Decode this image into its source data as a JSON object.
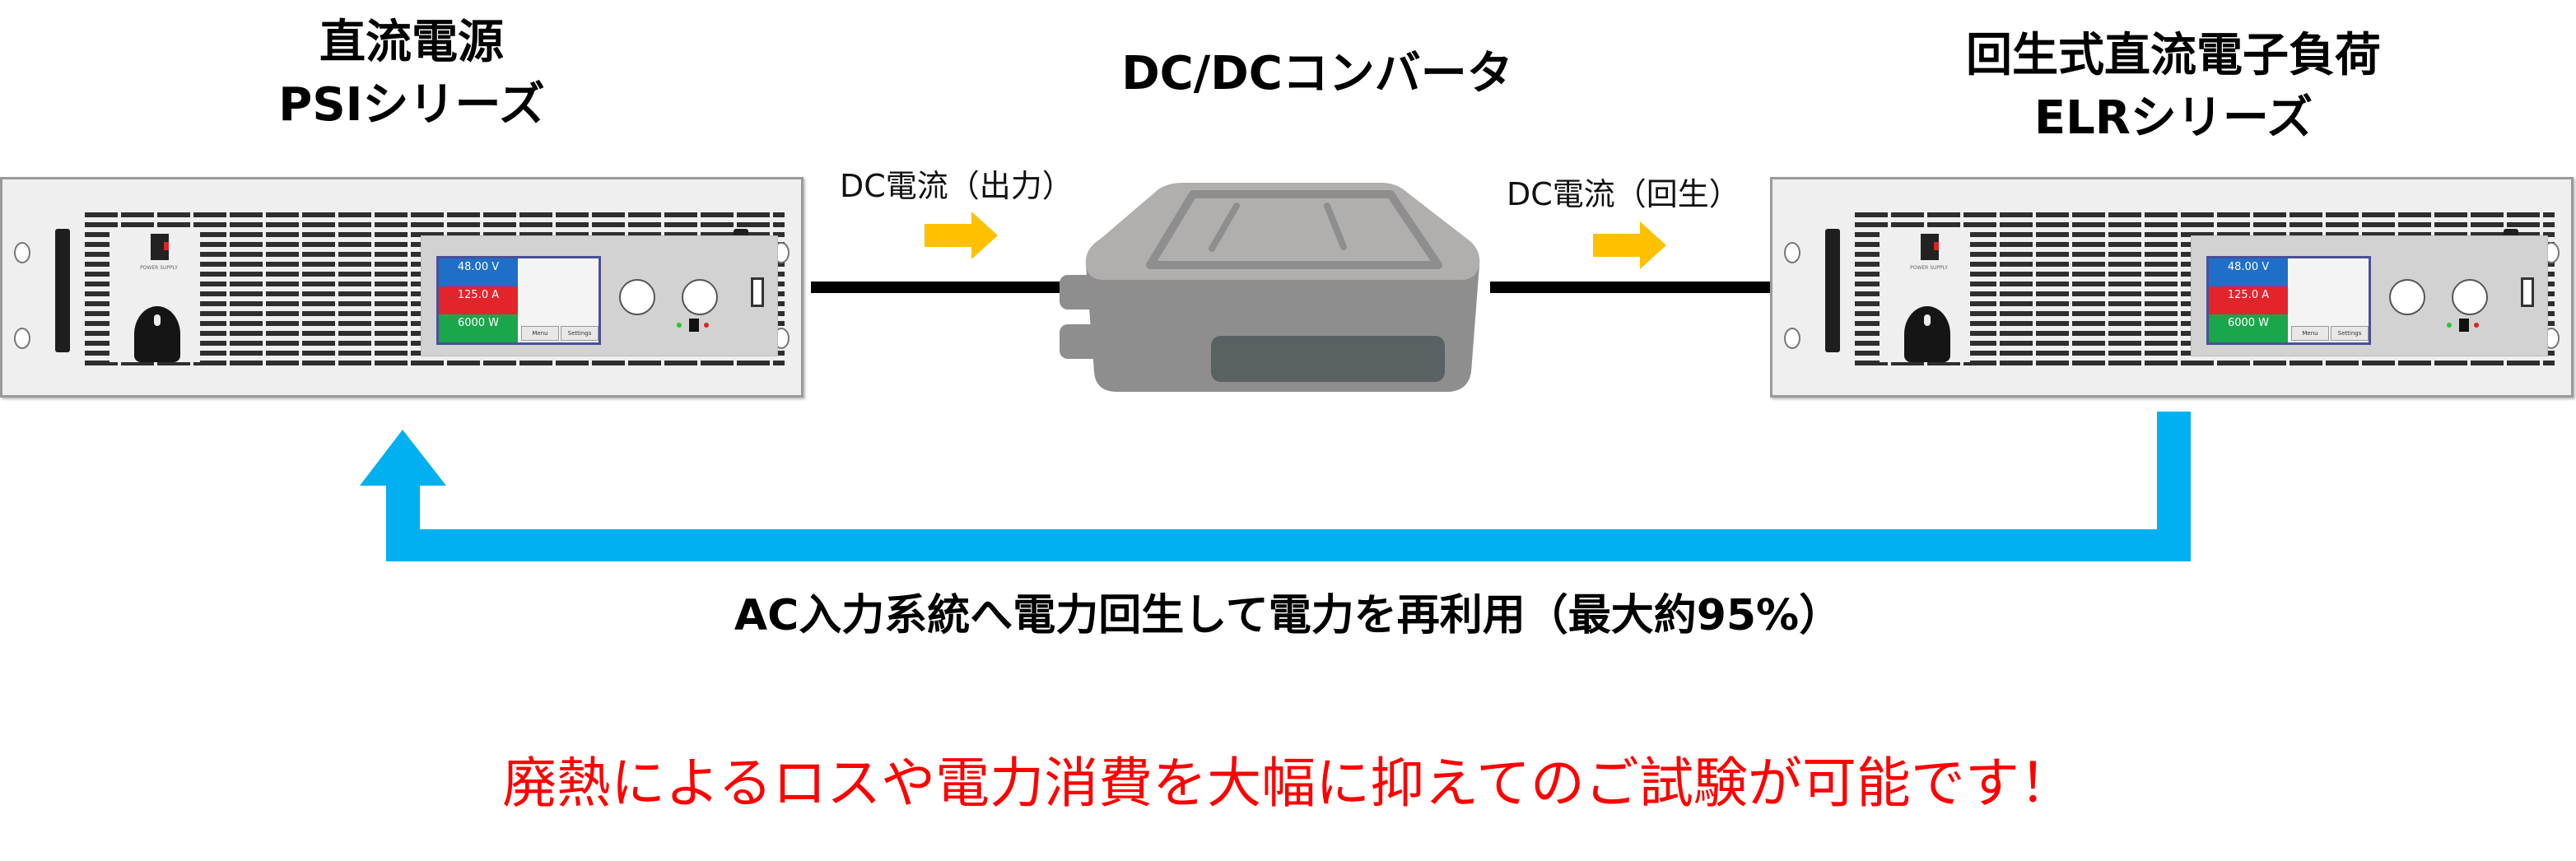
{
  "titles": {
    "psi": {
      "line1": "直流電源",
      "line2": "PSIシリーズ"
    },
    "converter": "DC/DCコンバータ",
    "elr": {
      "line1": "回生式直流電子負荷",
      "line2": "ELRシリーズ"
    }
  },
  "flow_labels": {
    "output": "DC電流（出力）",
    "regen": "DC電流（回生）"
  },
  "caption": "AC入力系統へ電力回生して電力を再利用（最大約95%）",
  "note": "廃熱によるロスや電力消費を大幅に抑えてのご試験が可能です！",
  "devices": {
    "psi": {
      "panel_text": "POWER SUPPLY",
      "display": {
        "voltage": "48.00 V",
        "current": "125.0 A",
        "power": "6000 W"
      },
      "buttons": [
        "Menu",
        "Settings"
      ]
    },
    "elr": {
      "panel_text": "POWER SUPPLY",
      "display": {
        "voltage": "48.00 V",
        "current": "125.0 A",
        "power": "6000 W"
      },
      "buttons": [
        "Menu",
        "Settings"
      ]
    }
  },
  "colors": {
    "flow_arrow": "#ffc000",
    "regen_arrow": "#00b0f0",
    "note_text": "#ff0000",
    "converter_body": "#8f8e8f",
    "converter_top": "#b1aeae",
    "converter_window": "#596163"
  }
}
